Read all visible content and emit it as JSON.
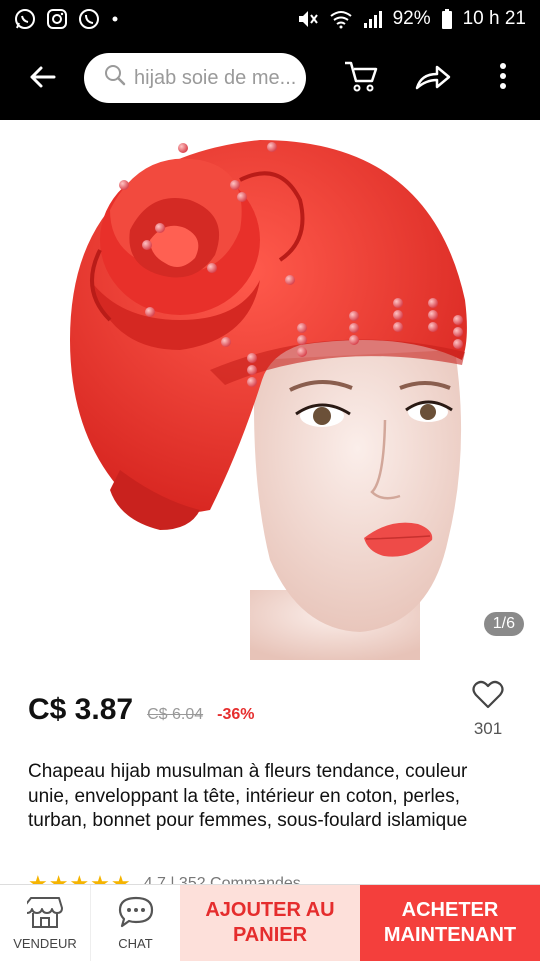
{
  "status": {
    "battery": "92%",
    "time": "10 h 21",
    "icons": [
      "whatsapp-icon",
      "instagram-icon",
      "phone-app-icon",
      "dot-icon",
      "mute-icon",
      "wifi-icon",
      "signal-icon",
      "battery-icon"
    ]
  },
  "toolbar": {
    "search_placeholder": "hijab soie de me...",
    "icons": [
      "back-arrow-icon",
      "search-icon",
      "cart-icon",
      "share-icon",
      "more-vert-icon"
    ]
  },
  "gallery": {
    "pager": "1/6",
    "colors": {
      "hat": "#ef3b35",
      "skin": "#f1d9d2"
    }
  },
  "product": {
    "price": "C$ 3.87",
    "old_price": "C$ 6.04",
    "discount": "-36%",
    "wishlist_count": "301",
    "title": "Chapeau hijab musulman à fleurs tendance, couleur unie, enveloppant la tête, intérieur en coton, perles, turban, bonnet pour femmes, sous-foulard islamique",
    "stars": "★★★★★",
    "rating_text": "4.7 | 352 Commandes"
  },
  "bottom_nav": {
    "vendor_label": "VENDEUR",
    "chat_label": "CHAT",
    "add_to_cart_label": "AJOUTER AU PANIER",
    "buy_now_label": "ACHETER MAINTENANT"
  },
  "colors": {
    "accent": "#f43f3c",
    "accent_light": "#fde0da",
    "discount": "#e62e2e",
    "star": "#f5b400"
  }
}
